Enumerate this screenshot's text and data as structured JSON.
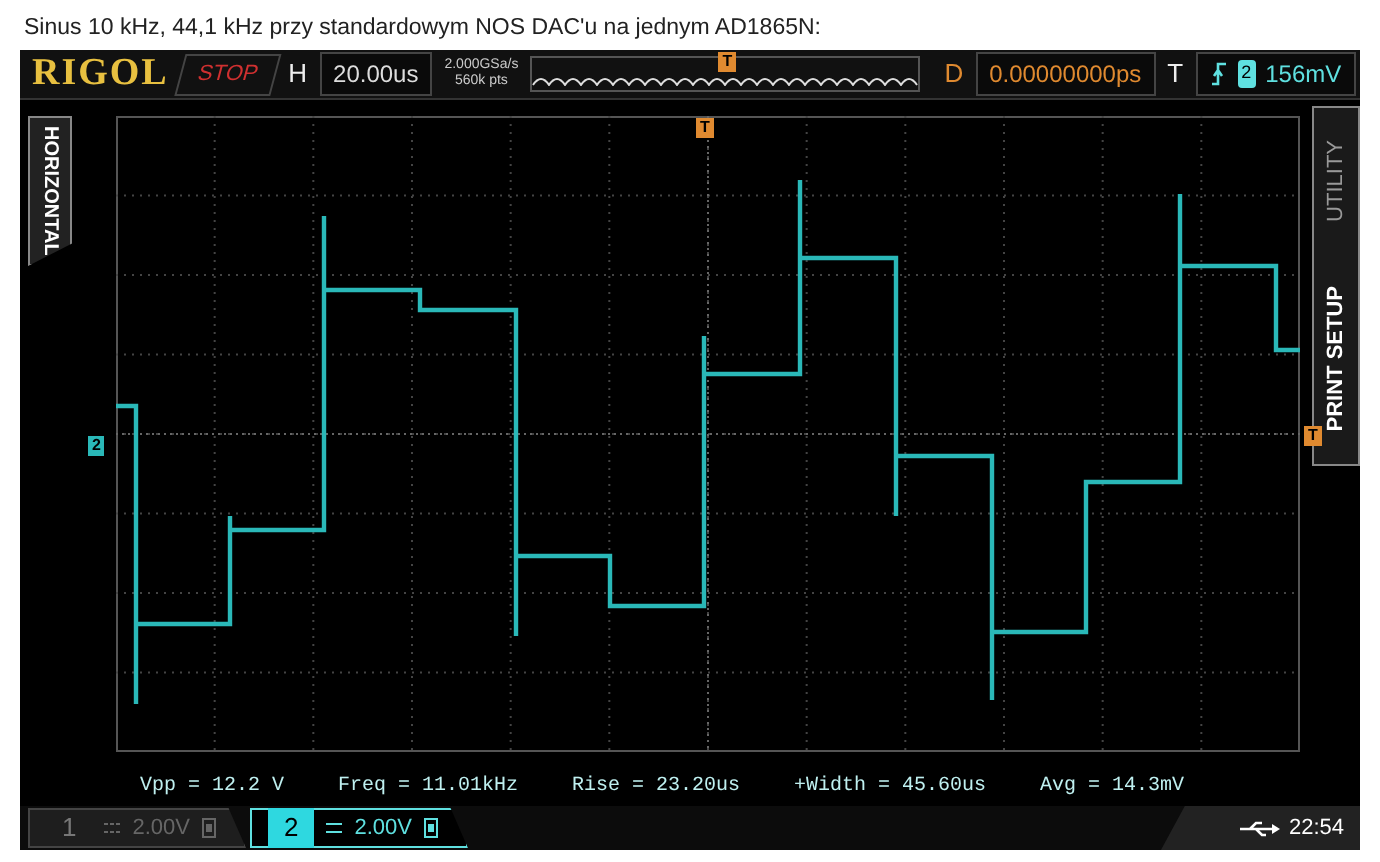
{
  "caption": "Sinus 10 kHz, 44,1 kHz przy standardowym NOS DAC'u na jednym AD1865N:",
  "scope": {
    "brand": "RIGOL",
    "run_state": "STOP",
    "horizontal": {
      "label": "H",
      "timebase": "20.00us",
      "sample_rate": "2.000GSa/s",
      "memory_depth": "560k pts"
    },
    "delay": {
      "label": "D",
      "value": "0.00000000ps"
    },
    "trigger": {
      "label": "T",
      "source": "2",
      "level": "156mV"
    },
    "left_tabs": [
      {
        "label": "HORIZONTAL",
        "selected": true
      }
    ],
    "right_tabs": [
      {
        "label": "PRINT SETUP",
        "selected": true
      },
      {
        "label": "UTILITY",
        "selected": false
      }
    ],
    "markers": {
      "overview_trigger": "T",
      "trigger_position": "T",
      "channel": "2",
      "trigger_level": "T"
    },
    "measurements": [
      "Vpp = 12.2 V",
      "Freq = 11.01kHz",
      "Rise = 23.20us",
      "+Width = 45.60us",
      "Avg = 14.3mV"
    ],
    "channels": [
      {
        "number": "1",
        "scale": "2.00V",
        "enabled": false
      },
      {
        "number": "2",
        "scale": "2.00V",
        "enabled": true
      }
    ],
    "clock": "22:54"
  }
}
